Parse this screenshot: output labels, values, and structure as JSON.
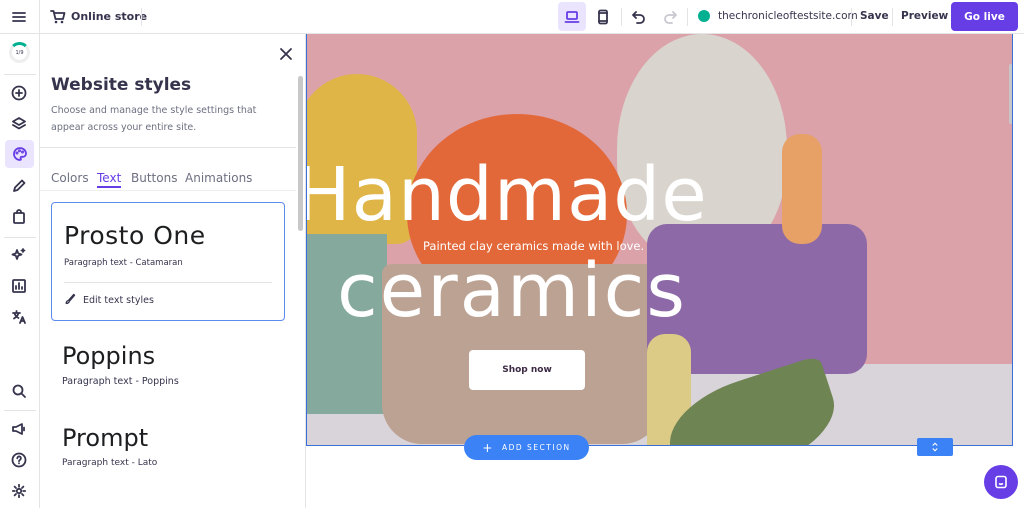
{
  "topbar": {
    "store_label": "Online store",
    "domain": "thechronicleoftestsite.com",
    "save": "Save",
    "preview": "Preview",
    "go_live": "Go live"
  },
  "rail": {
    "progress": "1/9",
    "progress_fraction": 0.11
  },
  "panel": {
    "title": "Website styles",
    "description": "Choose and manage the style settings that appear across your entire site.",
    "tabs": [
      "Colors",
      "Text",
      "Buttons",
      "Animations"
    ],
    "active_tab": "Text",
    "fonts": [
      {
        "heading": "Prosto One",
        "paragraph": "Paragraph text - Catamaran",
        "selected": true,
        "edit": "Edit text styles"
      },
      {
        "heading": "Poppins",
        "paragraph": "Paragraph text - Poppins"
      },
      {
        "heading": "Prompt",
        "paragraph": "Paragraph text - Lato"
      }
    ]
  },
  "hero": {
    "line1": "Handmade",
    "line2": "ceramics",
    "subtitle": "Painted clay ceramics made with love.",
    "cta": "Shop now"
  },
  "add_section": "ADD SECTION",
  "colors": {
    "accent": "#673de6",
    "blue": "#3b82f6",
    "status": "#00b090"
  }
}
